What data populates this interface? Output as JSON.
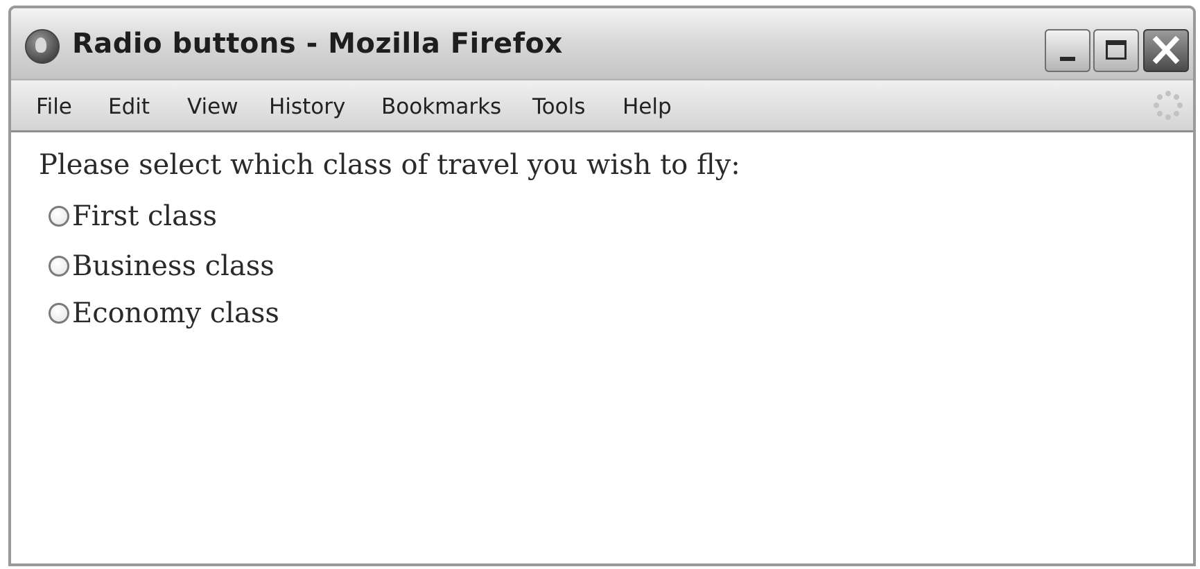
{
  "window": {
    "title": "Radio buttons - Mozilla Firefox",
    "app_icon": "firefox-icon",
    "controls": {
      "minimize_icon": "minimize-icon",
      "maximize_icon": "maximize-icon",
      "close_icon": "close-icon"
    }
  },
  "menubar": {
    "items": [
      {
        "label": "File"
      },
      {
        "label": "Edit"
      },
      {
        "label": "View"
      },
      {
        "label": "History"
      },
      {
        "label": "Bookmarks"
      },
      {
        "label": "Tools"
      },
      {
        "label": "Help"
      }
    ],
    "throbber_icon": "throbber-icon"
  },
  "content": {
    "prompt": "Please select which class of travel you wish to fly:",
    "options": [
      {
        "label": "First class",
        "checked": false
      },
      {
        "label": "Business class",
        "checked": false
      },
      {
        "label": "Economy class",
        "checked": false
      }
    ]
  }
}
